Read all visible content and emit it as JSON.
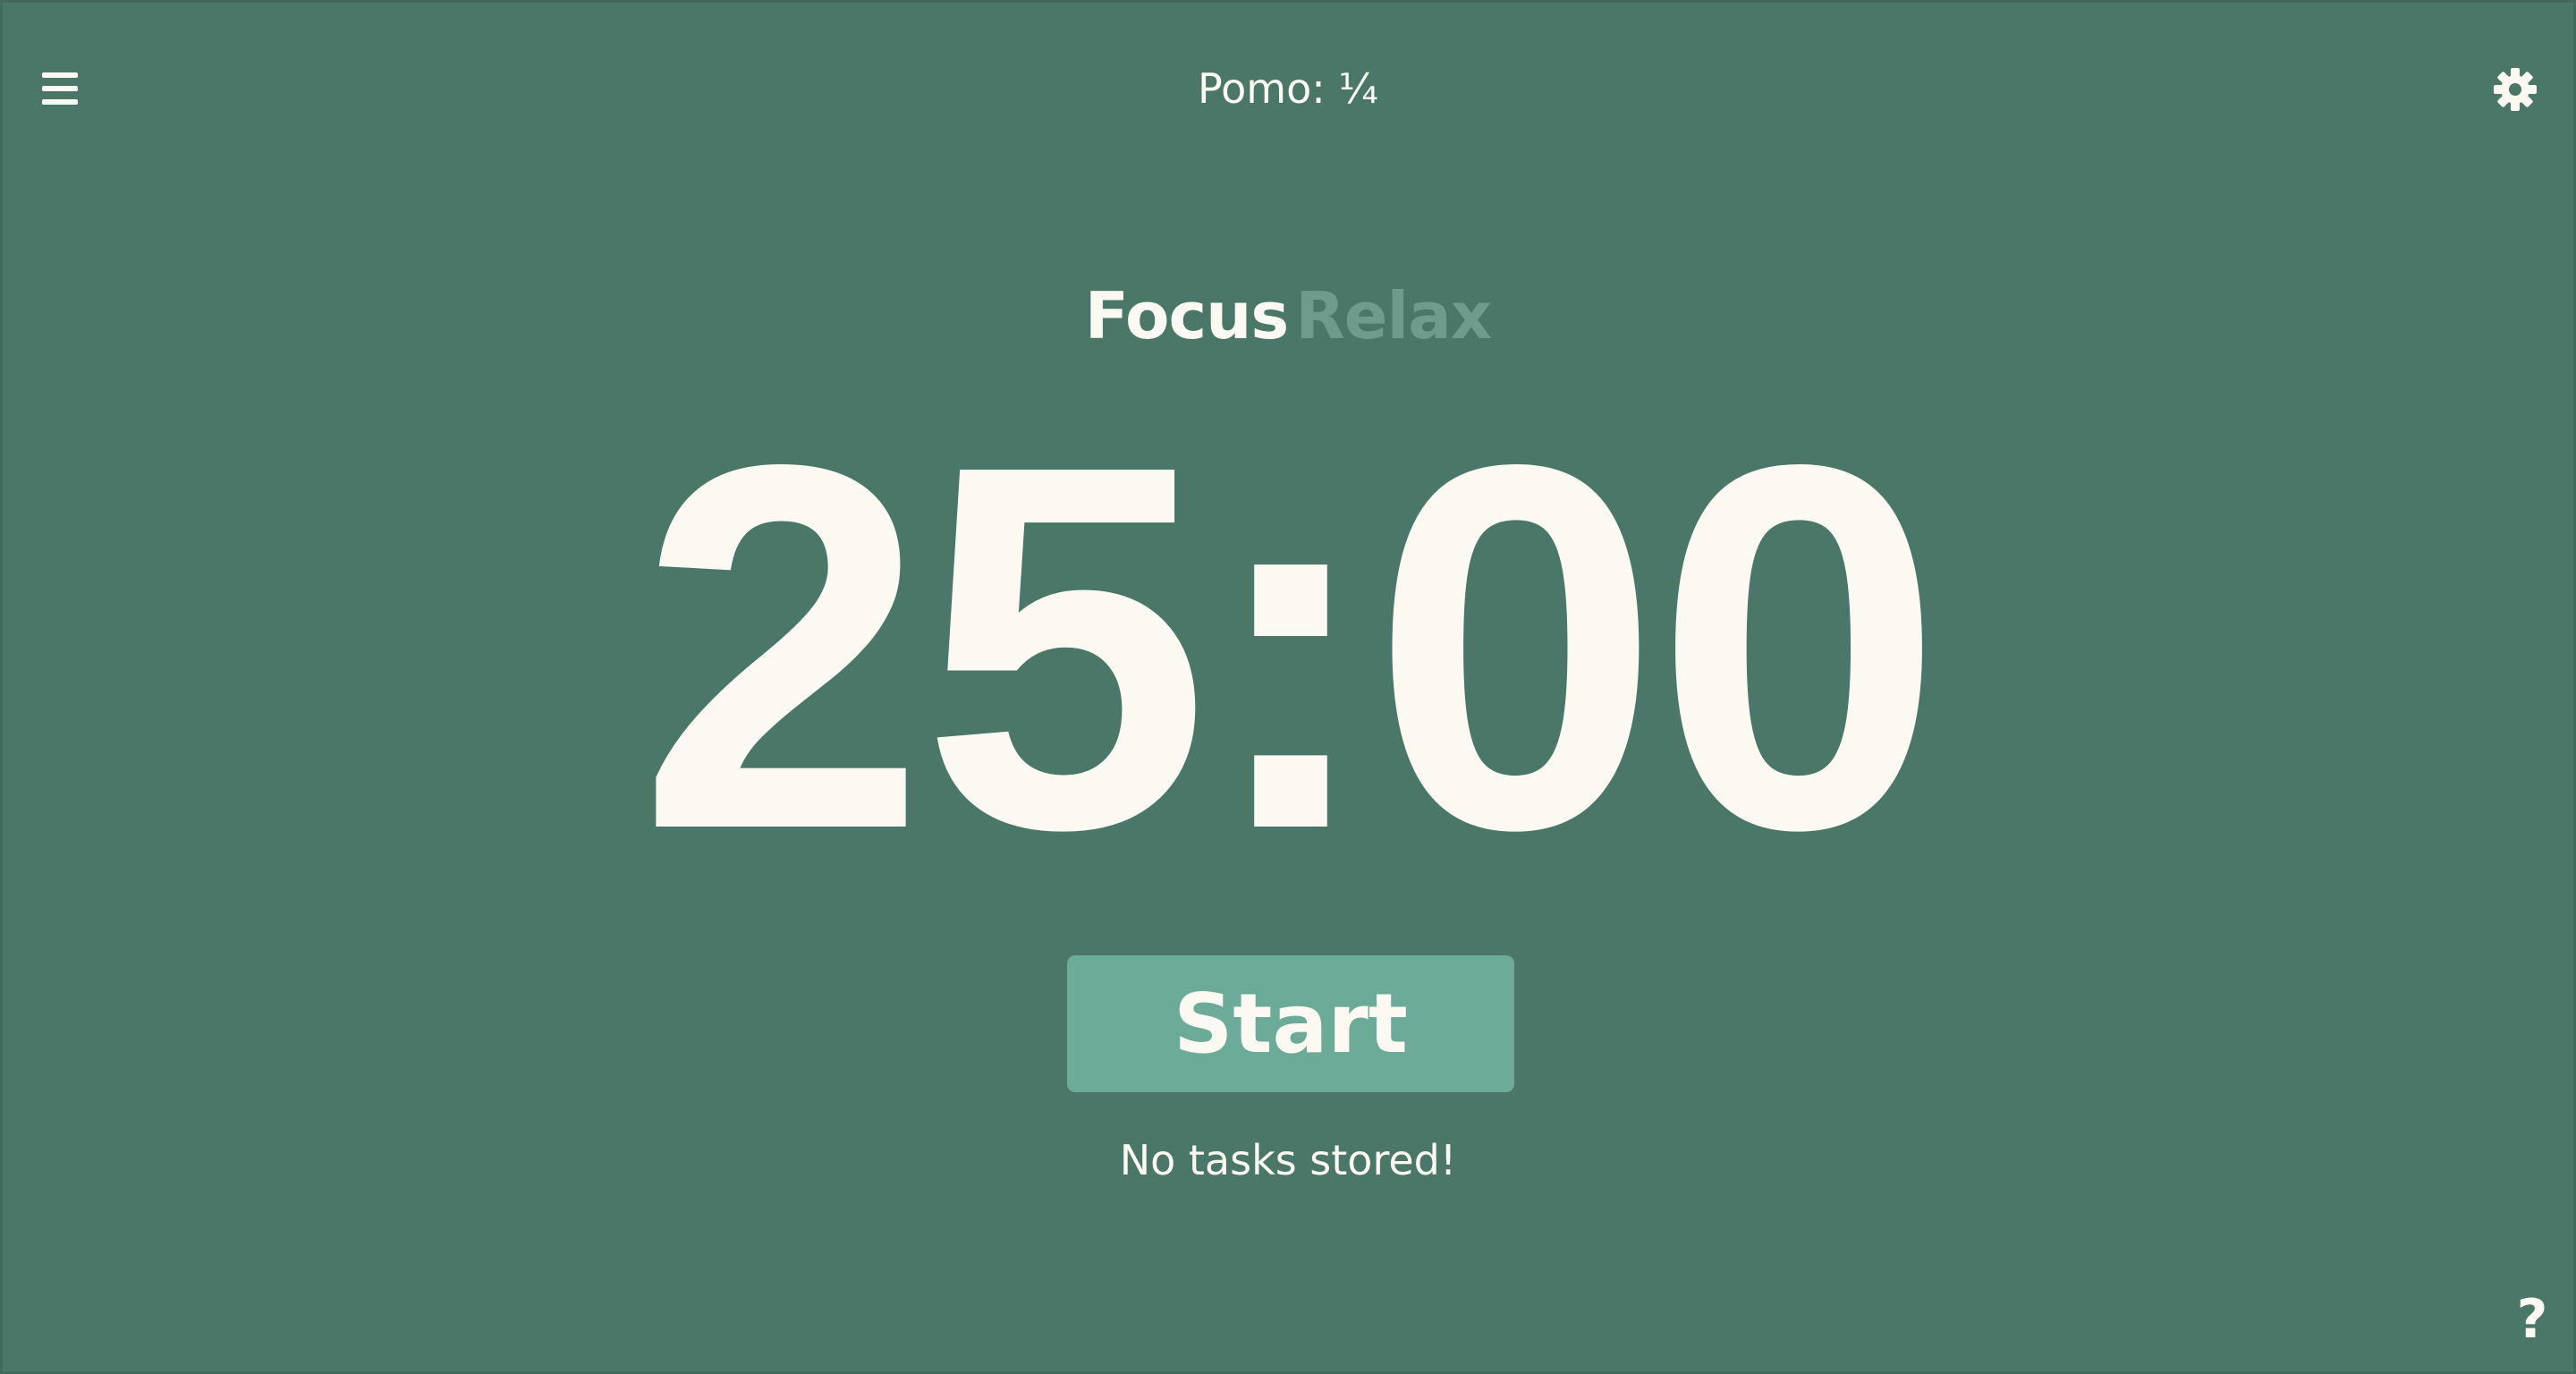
{
  "header": {
    "menu_icon": "hamburger-menu-icon",
    "pomo_count": "Pomo: ¼",
    "settings_icon": "gear-icon"
  },
  "mode": {
    "focus_label": "Focus",
    "relax_label": "Relax",
    "active": "Focus"
  },
  "timer": {
    "display": "25:00"
  },
  "controls": {
    "start_label": "Start"
  },
  "tasks": {
    "empty_message": "No tasks stored!"
  },
  "footer": {
    "help_label": "?"
  },
  "colors": {
    "background": "#4a7768",
    "text": "#fbf9f2",
    "inactive_mode": "#6e9b8b",
    "button": "#6cab97"
  }
}
